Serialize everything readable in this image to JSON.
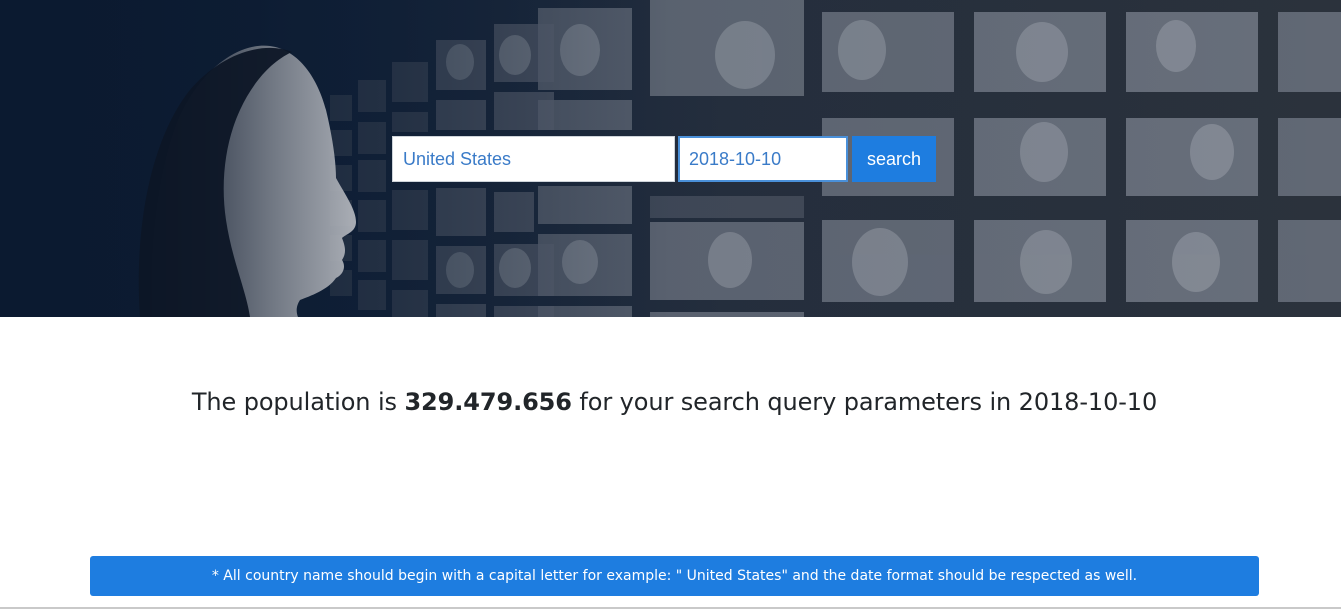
{
  "search": {
    "country_value": "United States",
    "date_value": "2018-10-10",
    "button_label": "search"
  },
  "result": {
    "prefix": "The population is",
    "population": "329.479.656",
    "middle": "for your search query parameters in",
    "date": "2018-10-10"
  },
  "notice": {
    "text": "* All country name should begin with a capital letter for example: \" United States\" and the date format should be respected as well."
  },
  "colors": {
    "accent": "#1e7de0",
    "hero_dark": "#0b1a30",
    "text": "#212529"
  }
}
